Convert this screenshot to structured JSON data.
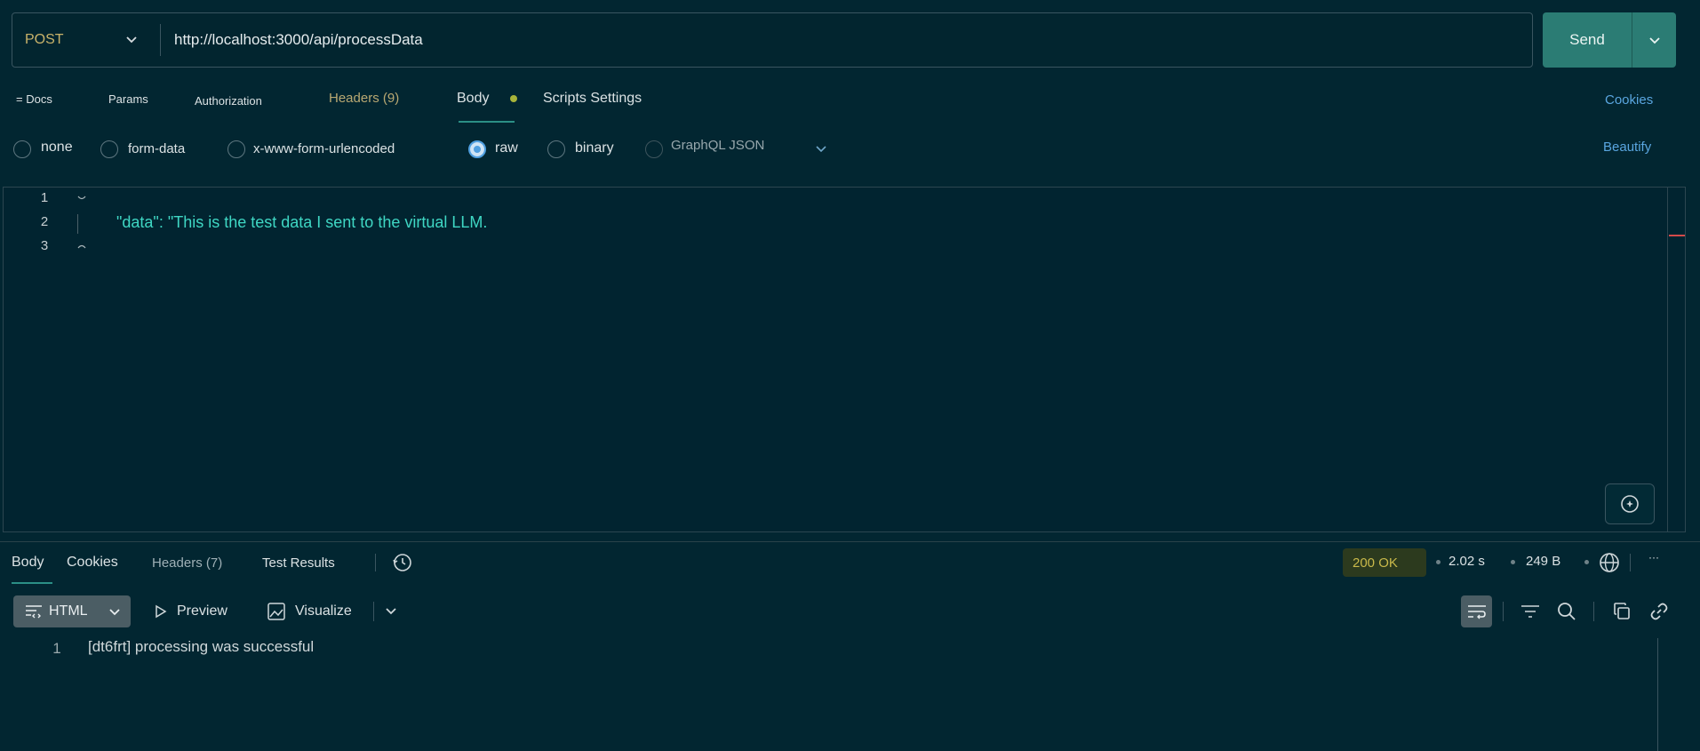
{
  "request": {
    "method": "POST",
    "url": "http://localhost:3000/api/processData",
    "send_label": "Send"
  },
  "request_tabs": {
    "docs": "= Docs",
    "params": "Params",
    "authorization": "Authorization",
    "headers": "Headers (9)",
    "body": "Body",
    "scripts_settings": "Scripts Settings",
    "cookies": "Cookies"
  },
  "body_types": {
    "none": "none",
    "form_data": "form-data",
    "urlencoded": "x-www-form-urlencoded",
    "raw": "raw",
    "binary": "binary",
    "graphql": "GraphQL JSON",
    "selected": "raw",
    "beautify": "Beautify"
  },
  "editor": {
    "line_numbers": [
      "1",
      "2",
      "3"
    ],
    "line2": "\"data\": \"This is the test data I sent to the virtual LLM."
  },
  "response_tabs": {
    "body": "Body",
    "cookies": "Cookies",
    "headers": "Headers (7)",
    "test_results": "Test Results"
  },
  "response_meta": {
    "status": "200 OK",
    "time": "2.02 s",
    "size": "249 B",
    "more": "···"
  },
  "response_toolbar": {
    "format": "HTML",
    "preview": "Preview",
    "visualize": "Visualize"
  },
  "response_body": {
    "line_number": "1",
    "text": "[dt6frt] processing was successful"
  },
  "colors": {
    "background": "#022631",
    "accent": "#2b7c74",
    "code": "#3fd7c4",
    "link": "#5aa6e0",
    "status_text": "#c9b94a"
  }
}
